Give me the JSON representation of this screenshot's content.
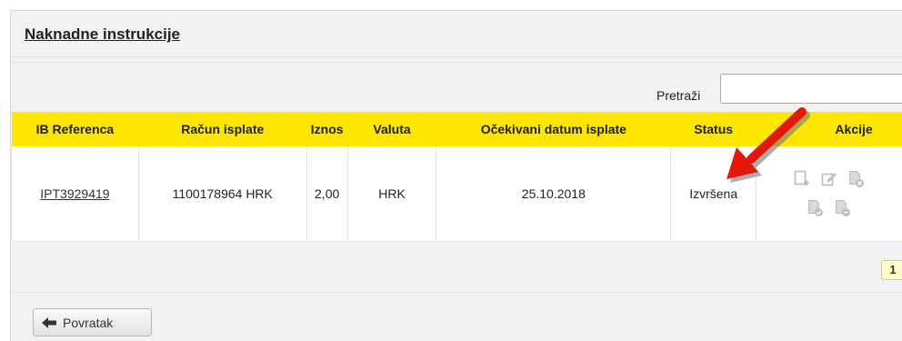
{
  "panel": {
    "title": "Naknadne instrukcije"
  },
  "search": {
    "label": "Pretraži",
    "value": ""
  },
  "table": {
    "columns": [
      "IB Referenca",
      "Račun isplate",
      "Iznos",
      "Valuta",
      "Očekivani datum isplate",
      "Status",
      "Akcije"
    ],
    "rows": [
      {
        "reference": "IPT3929419",
        "account": "1100178964 HRK",
        "amount": "2,00",
        "currency": "HRK",
        "expected_date": "25.10.2018",
        "status": "Izvršena"
      }
    ],
    "action_icons": [
      "add-note-icon",
      "edit-icon",
      "cancel-icon",
      "approve-icon",
      "reject-icon"
    ]
  },
  "pagination": {
    "current_page": "1"
  },
  "back_button": {
    "label": "Povratak"
  },
  "colors": {
    "header_bg": "#ffe600",
    "annotation_arrow": "#e3170a",
    "pager_bg": "#ffffcc"
  }
}
